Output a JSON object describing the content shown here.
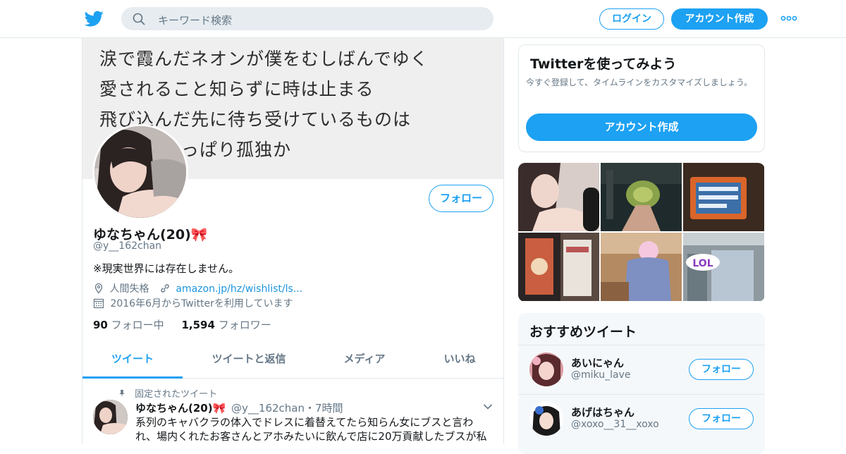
{
  "header": {
    "search_placeholder": "キーワード検索",
    "login_label": "ログイン",
    "signup_label": "アカウント作成"
  },
  "profile": {
    "banner_lines": [
      "涙で霞んだネオンが僕をむしばんでゆく",
      "愛されること知らずに時は止まる",
      "飛び込んだ先に待ち受けているものは",
      "っぱり孤独か"
    ],
    "follow_label": "フォロー",
    "name": "ゆなちゃん(20)🎀",
    "handle": "@y__162chan",
    "bio": "※現実世界には存在しません。",
    "location": "人間失格",
    "url": "amazon.jp/hz/wishlist/ls...",
    "joined": "2016年6月からTwitterを利用しています",
    "following_count": "90",
    "following_label": "フォロー中",
    "followers_count": "1,594",
    "followers_label": "フォロワー"
  },
  "tabs": [
    {
      "label": "ツイート"
    },
    {
      "label": "ツイートと返信"
    },
    {
      "label": "メディア"
    },
    {
      "label": "いいね"
    }
  ],
  "pinned_tweet": {
    "pinned_label": "固定されたツイート",
    "name": "ゆなちゃん(20)🎀",
    "handle": "@y__162chan",
    "time": "・7時間",
    "text": "系列のキャバクラの体入でドレスに着替えてたら知らん女にブスと言われ、場内くれたお客さんとアホみたいに飲んで店に20万貢献したブスが私"
  },
  "signup_card": {
    "title": "Twitterを使ってみよう",
    "description": "今すぐ登録して、タイムラインをカスタマイズしましょう。",
    "button_label": "アカウント作成"
  },
  "media_grid": {
    "overlay_label": "LOL"
  },
  "recommendations": {
    "title": "おすすめツイート",
    "items": [
      {
        "name": "あいにゃん",
        "handle": "@miku_lave",
        "follow_label": "フォロー"
      },
      {
        "name": "あげはちゃん",
        "handle": "@xoxo__31__xoxo",
        "follow_label": "フォロー"
      }
    ]
  },
  "colors": {
    "accent": "#1da1f2",
    "link": "#1b95e0",
    "muted": "#657786"
  }
}
